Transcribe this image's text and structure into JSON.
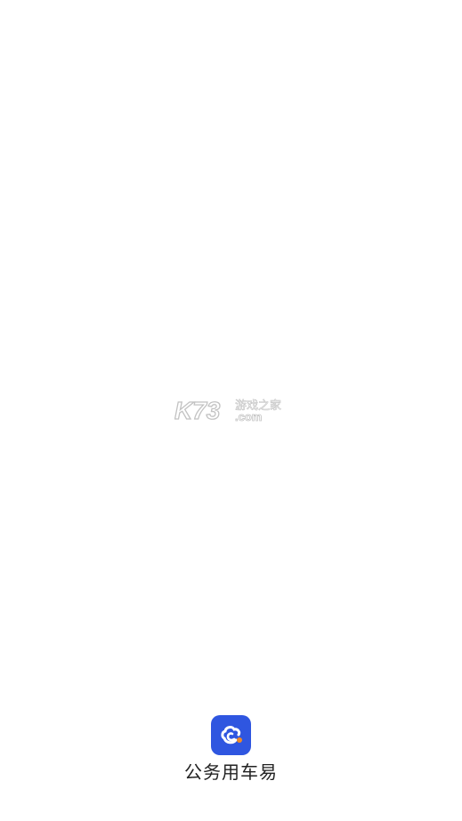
{
  "watermark": {
    "brand": "K73",
    "tagline": "游戏之家",
    "domain": ".com"
  },
  "app": {
    "name": "公务用车易",
    "icon": "cloud-car-icon",
    "icon_color": "#2f56e0",
    "accent_dot_color": "#f08a24"
  }
}
